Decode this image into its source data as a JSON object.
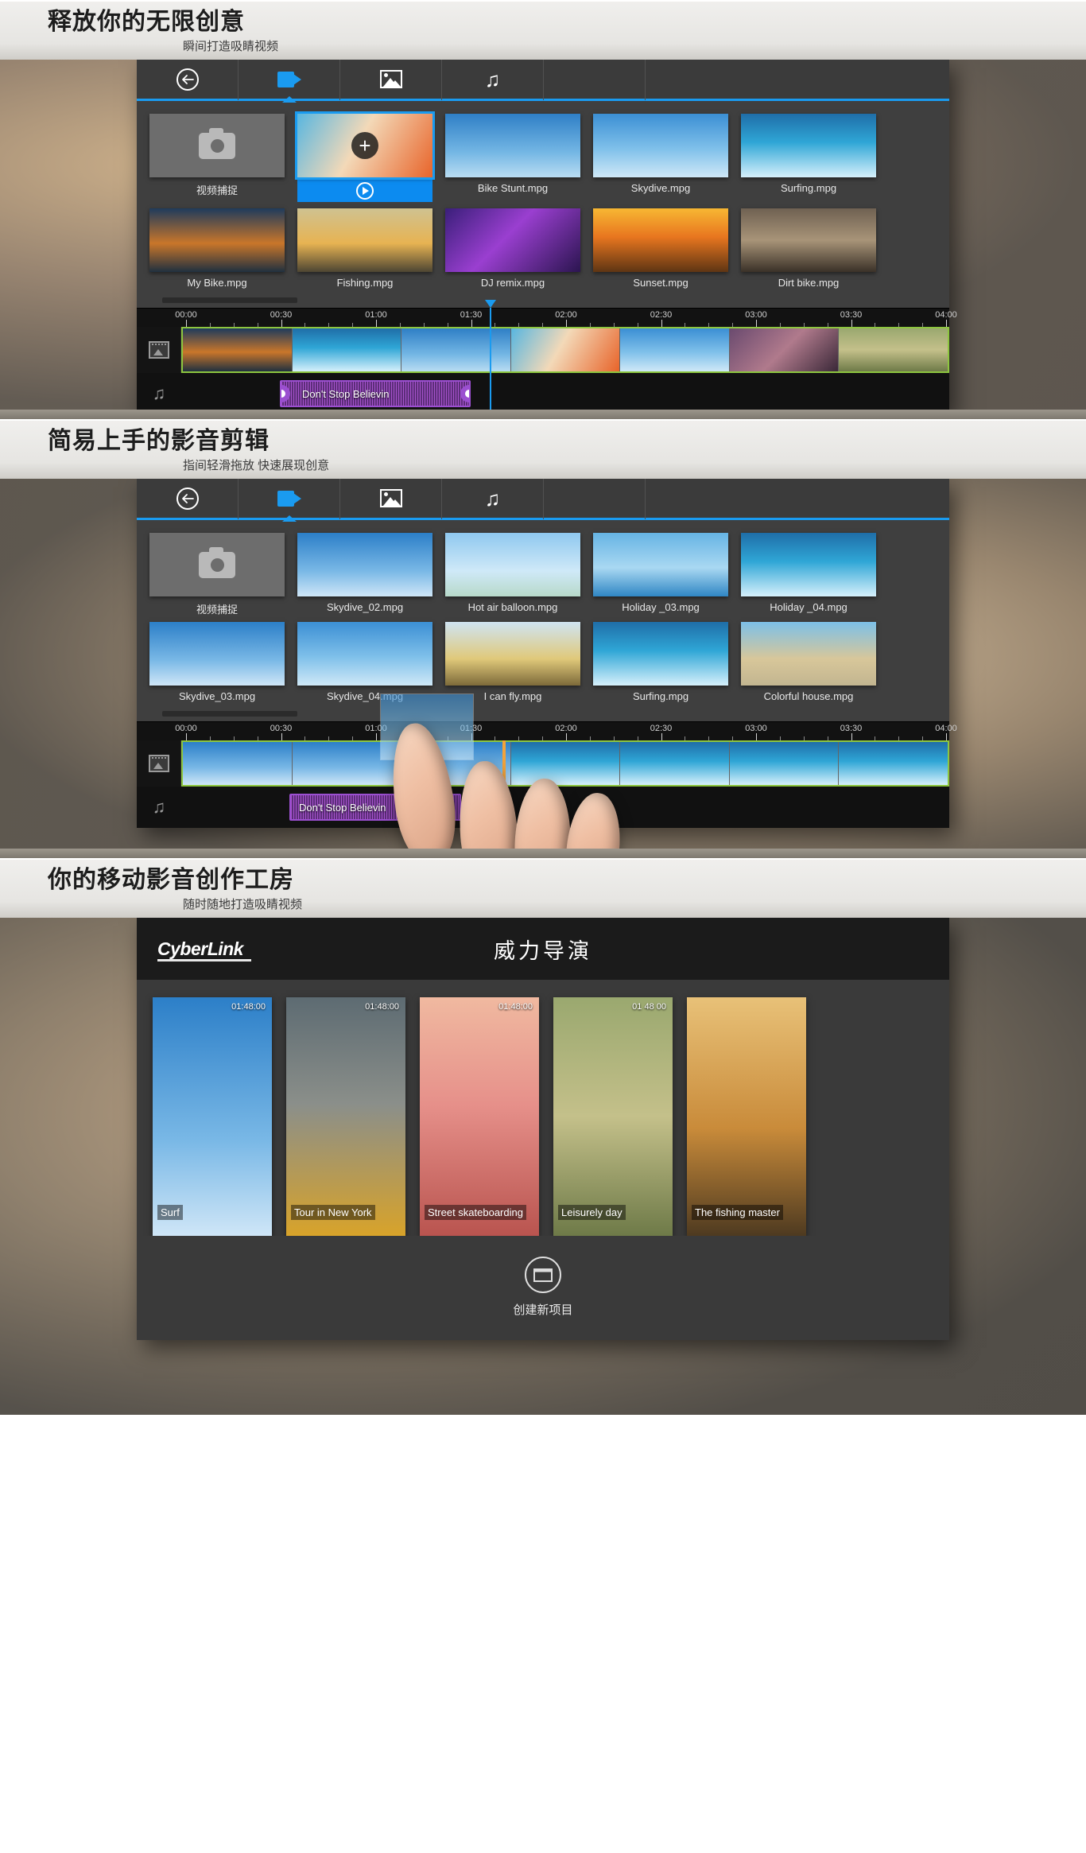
{
  "sections": [
    {
      "heading": "释放你的无限创意",
      "subheading": "瞬间打造吸睛视频"
    },
    {
      "heading": "简易上手的影音剪辑",
      "subheading": "指间轻滑拖放 快速展现创意"
    },
    {
      "heading": "你的移动影音创作工房",
      "subheading": "随时随地打造吸睛视频"
    }
  ],
  "toolbar": {
    "back_icon": "back-arrow-icon",
    "tabs": [
      {
        "icon": "video-camera-icon",
        "active": true
      },
      {
        "icon": "image-icon",
        "active": false
      },
      {
        "icon": "music-note-icon",
        "active": false
      }
    ]
  },
  "editor1": {
    "capture_label": "视频捕捉",
    "row1": [
      {
        "name": "",
        "selected": true,
        "style": "ph-run"
      },
      {
        "name": "Bike Stunt.mpg",
        "selected": false,
        "style": "ph-bmx"
      },
      {
        "name": "Skydive.mpg",
        "selected": false,
        "style": "ph-sky"
      },
      {
        "name": "Surfing.mpg",
        "selected": false,
        "style": "ph-surf"
      }
    ],
    "row2": [
      {
        "name": "My Bike.mpg",
        "style": "ph-dusk"
      },
      {
        "name": "Fishing.mpg",
        "style": "ph-fish"
      },
      {
        "name": "DJ remix.mpg",
        "style": "ph-dj"
      },
      {
        "name": "Sunset.mpg",
        "style": "ph-sunset"
      },
      {
        "name": "Dirt bike.mpg",
        "style": "ph-dirt"
      }
    ],
    "ruler": [
      "00:00",
      "00:30",
      "01:00",
      "01:30",
      "02:00",
      "02:30",
      "03:00",
      "03:30",
      "04:00"
    ],
    "video_clips": [
      "ph-dusk",
      "ph-surf",
      "ph-bmx",
      "ph-run",
      "ph-sky",
      "ph-blur",
      "ph-bike"
    ],
    "audio_clip_name": "Don't Stop Believin",
    "playhead_time": "02:00"
  },
  "editor2": {
    "capture_label": "视频捕捉",
    "row1": [
      {
        "name": "Skydive_02.mpg",
        "style": "ph-skydv"
      },
      {
        "name": "Hot air balloon.mpg",
        "style": "ph-balloon"
      },
      {
        "name": "Holiday _03.mpg",
        "style": "ph-sail"
      },
      {
        "name": "Holiday _04.mpg",
        "style": "ph-surf"
      }
    ],
    "row2": [
      {
        "name": "Skydive_03.mpg",
        "style": "ph-skydv"
      },
      {
        "name": "Skydive_04.mpg",
        "style": "ph-sky"
      },
      {
        "name": "I can fly.mpg",
        "style": "ph-plane"
      },
      {
        "name": "Surfing.mpg",
        "style": "ph-surf"
      },
      {
        "name": "Colorful house.mpg",
        "style": "ph-houses"
      }
    ],
    "ruler": [
      "00:00",
      "00:30",
      "01:00",
      "01:30",
      "02:00",
      "02:30",
      "03:00",
      "03:30",
      "04:00"
    ],
    "video_clips": [
      "ph-skydv",
      "ph-skydv",
      "ph-skydv",
      "ph-surf",
      "ph-surf",
      "ph-surf",
      "ph-surf"
    ],
    "audio_clip_name": "Don't Stop Believin"
  },
  "gallery": {
    "brand": "CyberLink",
    "app_title": "威力导演",
    "projects": [
      {
        "title": "Surf",
        "duration": "01:48:00",
        "style": "ph-skydv"
      },
      {
        "title": "Tour in New York",
        "duration": "01:48:00",
        "style": "ph-city"
      },
      {
        "title": "Street skateboarding",
        "duration": "01:48:00",
        "style": "ph-skate"
      },
      {
        "title": "Leisurely day",
        "duration": "01 48 00",
        "style": "ph-bike"
      },
      {
        "title": "The fishing master",
        "duration": "",
        "style": "ph-fishman"
      }
    ],
    "new_project_label": "创建新项目",
    "new_project_icon": "clapperboard-icon"
  },
  "colors": {
    "accent": "#1a9bf0",
    "track_green": "#8dc63f",
    "audio_purple": "#9b4fd0",
    "drop_orange": "#f2a33c"
  }
}
